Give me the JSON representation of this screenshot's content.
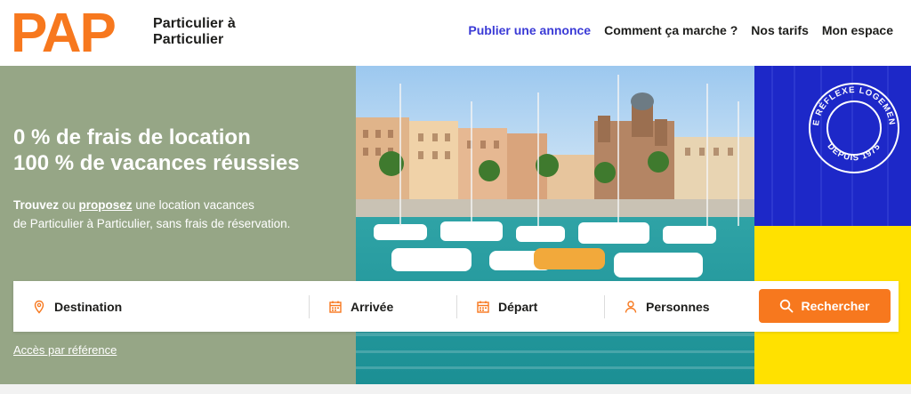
{
  "brand": {
    "logo_text": "PAP",
    "tagline_line1": "Particulier à",
    "tagline_line2": "Particulier",
    "color": "#f7781e"
  },
  "nav": {
    "items": [
      {
        "label": "Publier une annonce",
        "primary": true
      },
      {
        "label": "Comment ça marche ?"
      },
      {
        "label": "Nos tarifs"
      },
      {
        "label": "Mon espace"
      }
    ]
  },
  "hero": {
    "headline_line1": "0 % de frais de location",
    "headline_line2": "100 % de vacances réussies",
    "intro_bold1": "Trouvez",
    "intro_or": " ou ",
    "intro_link": "proposez",
    "intro_rest1": " une location vacances",
    "intro_rest2": "de Particulier à Particulier, sans frais de réservation.",
    "badge_text_top": "LE RÉFLEXE LOGEMENT",
    "badge_text_bottom": "DEPUIS 1975",
    "colors": {
      "sage": "#96a686",
      "blue": "#1d28c8",
      "yellow": "#ffe100"
    }
  },
  "search": {
    "destination": "Destination",
    "arrival": "Arrivée",
    "departure": "Départ",
    "persons": "Personnes",
    "submit": "Rechercher"
  },
  "ref_link": "Accès par référence"
}
